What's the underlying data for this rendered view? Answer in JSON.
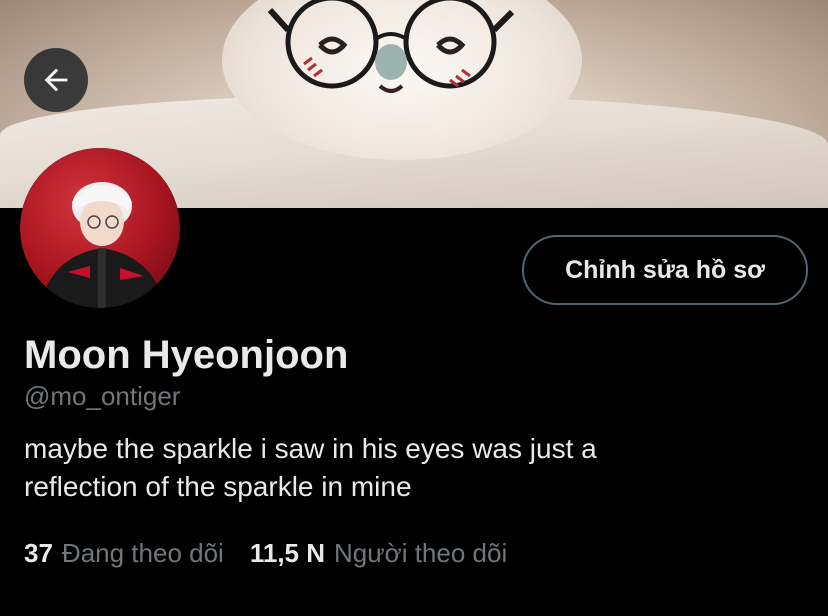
{
  "header": {
    "back_icon": "arrow-left-icon",
    "banner_image": "plush-toy-with-glasses-photo"
  },
  "profile": {
    "avatar_image": "profile-photo",
    "edit_button_label": "Chỉnh sửa hồ sơ",
    "display_name": "Moon Hyeonjoon",
    "handle": "@mo_ontiger",
    "bio_line1": "maybe the sparkle i saw in his eyes was just a",
    "bio_line2": "reflection of the sparkle in mine"
  },
  "stats": {
    "following_count": "37",
    "following_label": "Đang theo dõi",
    "followers_count": "11,5 N",
    "followers_label": "Người theo dõi"
  },
  "colors": {
    "background": "#000000",
    "text_primary": "#e7e9ea",
    "text_secondary": "#71767b",
    "button_border": "#536471"
  }
}
